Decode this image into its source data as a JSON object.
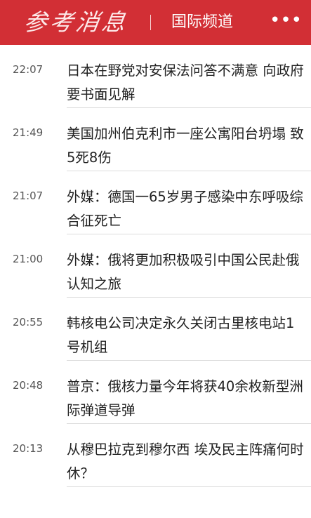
{
  "header": {
    "logo_text": "参考消息",
    "channel_title": "国际频道",
    "more_icon": "ellipsis-icon",
    "more_glyph": "•••",
    "accent_color": "#d22f35"
  },
  "news": [
    {
      "time": "22:07",
      "title": "日本在野党对安保法问答不满意 向政府要书面见解"
    },
    {
      "time": "21:49",
      "title": "美国加州伯克利市一座公寓阳台坍塌 致5死8伤"
    },
    {
      "time": "21:07",
      "title": "外媒：德国一65岁男子感染中东呼吸综合征死亡"
    },
    {
      "time": "21:00",
      "title": "外媒：俄将更加积极吸引中国公民赴俄认知之旅"
    },
    {
      "time": "20:55",
      "title": "韩核电公司决定永久关闭古里核电站1号机组"
    },
    {
      "time": "20:48",
      "title": "普京：俄核力量今年将获40余枚新型洲际弹道导弹"
    },
    {
      "time": "20:13",
      "title": "从穆巴拉克到穆尔西 埃及民主阵痛何时休？"
    }
  ]
}
